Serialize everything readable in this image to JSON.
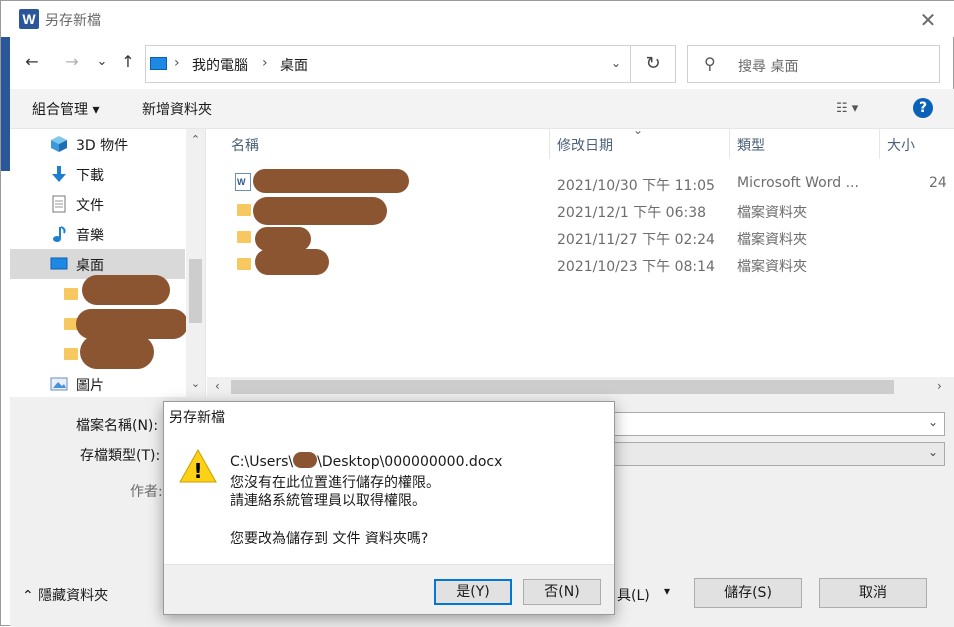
{
  "window": {
    "app_icon_letter": "W",
    "title": "另存新檔",
    "close_glyph": "✕"
  },
  "nav": {
    "back": "←",
    "forward": "→",
    "recent": "⌄",
    "up": "↑",
    "breadcrumb": [
      "我的電腦",
      "桌面"
    ],
    "separator": "›",
    "dropdown": "⌄",
    "refresh": "↻",
    "search_icon": "⚲",
    "search_placeholder": "搜尋 桌面"
  },
  "toolbar": {
    "organize": "組合管理 ▾",
    "new_folder": "新增資料夾",
    "view_icon": "☷  ▾",
    "help": "?"
  },
  "sidebar": {
    "items": [
      {
        "label": "3D 物件",
        "icon": "cube-icon"
      },
      {
        "label": "下載",
        "icon": "download-icon"
      },
      {
        "label": "文件",
        "icon": "document-icon"
      },
      {
        "label": "音樂",
        "icon": "music-icon"
      },
      {
        "label": "桌面",
        "icon": "desktop-icon",
        "selected": true
      },
      {
        "label": "圖片",
        "icon": "pictures-icon"
      }
    ],
    "scroll_up": "⌃",
    "scroll_down": "⌄"
  },
  "filelist": {
    "columns": [
      "名稱",
      "修改日期",
      "類型",
      "大小"
    ],
    "sort_arrow": "⌄",
    "rows": [
      {
        "date": "2021/10/30 下午 11:05",
        "type": "Microsoft Word ...",
        "size": "24",
        "icon": "word-doc-icon"
      },
      {
        "date": "2021/12/1 下午 06:38",
        "type": "檔案資料夾",
        "size": "",
        "icon": "folder-icon"
      },
      {
        "date": "2021/11/27 下午 02:24",
        "type": "檔案資料夾",
        "size": "",
        "icon": "folder-icon"
      },
      {
        "date": "2021/10/23 下午 08:14",
        "type": "檔案資料夾",
        "size": "",
        "icon": "folder-icon"
      }
    ],
    "scroll_left": "‹",
    "scroll_right": "›"
  },
  "form": {
    "filename_label": "檔案名稱(N):",
    "filetype_label": "存檔類型(T):",
    "author_label": "作者:",
    "hide_folders": "⌃  隱藏資料夾",
    "tools_label": "具(L)",
    "tools_arrow": "▾",
    "save": "儲存(S)",
    "cancel": "取消",
    "dropdown": "⌄"
  },
  "dialog": {
    "title": "另存新檔",
    "path_prefix": "C:\\Users\\",
    "path_suffix": "\\Desktop\\000000000.docx",
    "line2": "您沒有在此位置進行儲存的權限。",
    "line3": "請連絡系統管理員以取得權限。",
    "line4": "您要改為儲存到 文件 資料夾嗎?",
    "warning_glyph": "!",
    "yes": "是(Y)",
    "no": "否(N)"
  },
  "colors": {
    "accent": "#0078d7",
    "word_blue": "#2b579a",
    "redaction": "#8a5530",
    "warning": "#fcd116"
  }
}
